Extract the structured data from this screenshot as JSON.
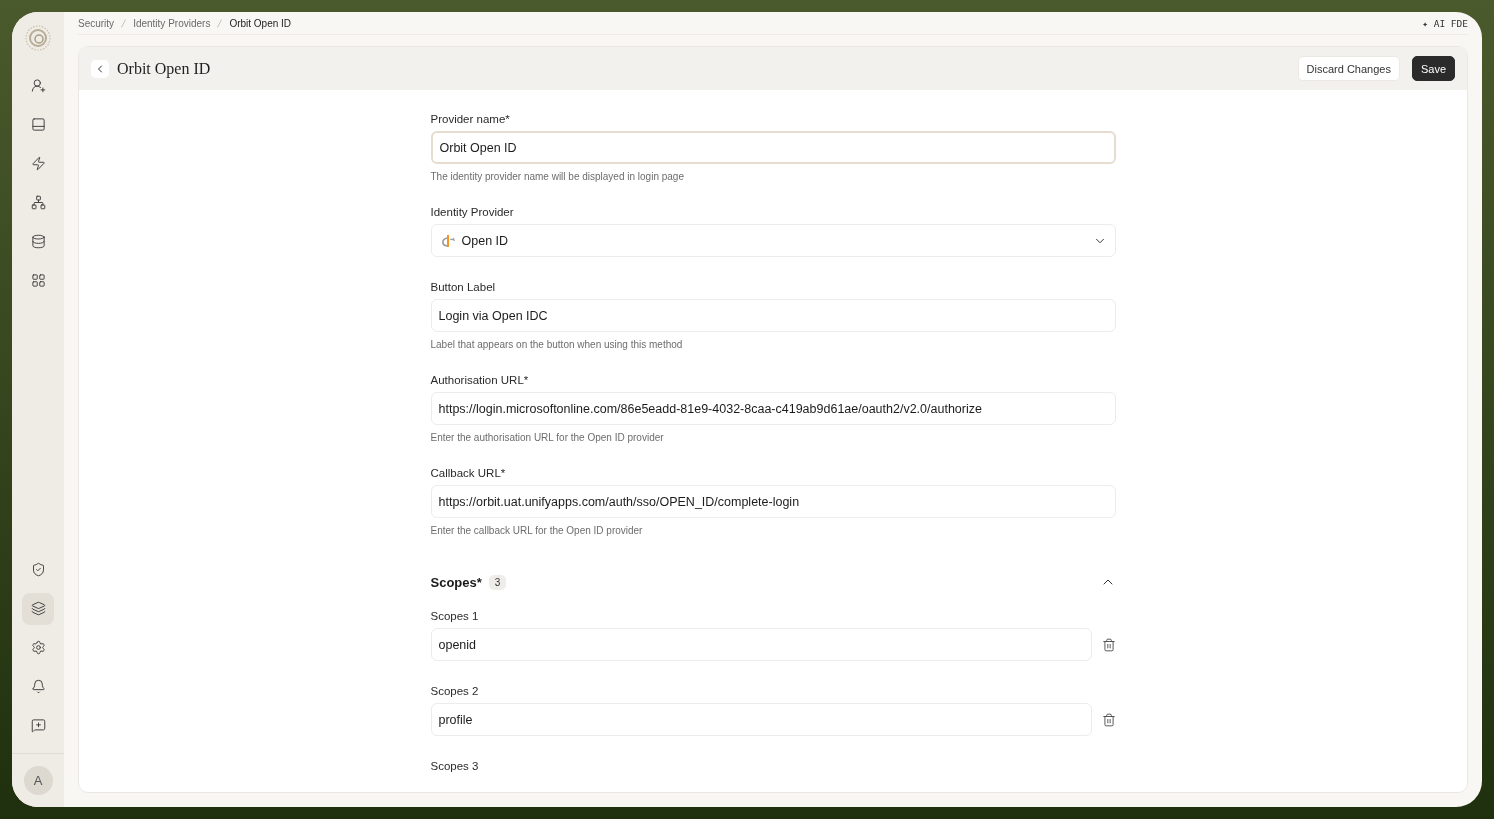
{
  "sidebar": {
    "top_items": [
      {
        "selected": false
      },
      {
        "selected": false
      },
      {
        "selected": false
      },
      {
        "selected": false
      },
      {
        "selected": false
      },
      {
        "selected": false
      }
    ],
    "bottom_items": [
      {
        "selected": false
      },
      {
        "selected": true
      },
      {
        "selected": false
      },
      {
        "selected": false
      },
      {
        "selected": false
      }
    ],
    "avatar": "A"
  },
  "breadcrumbs": [
    "Security",
    "Identity Providers",
    "Orbit Open ID"
  ],
  "assistant": {
    "icon": "✦",
    "label": "AI FDE"
  },
  "header": {
    "title": "Orbit Open ID",
    "buttons": [
      {
        "label": "Discard Changes",
        "kind": "secondary"
      },
      {
        "label": "Save",
        "kind": "primary"
      }
    ]
  },
  "fields": [
    {
      "kind": "text",
      "label": "Provider name*",
      "value": "Orbit Open ID",
      "focused": true,
      "hint": "The identity provider name will be displayed in login page"
    },
    {
      "kind": "select",
      "label": "Identity Provider",
      "value": "Open ID",
      "focused": false
    },
    {
      "kind": "text",
      "label": "Button Label",
      "value": "Login via Open IDC",
      "focused": false,
      "hint": "Label that appears on the button when using this method"
    },
    {
      "kind": "text",
      "label": "Authorisation URL*",
      "value": "https://login.microsoftonline.com/86e5eadd-81e9-4032-8caa-c419ab9d61ae/oauth2/v2.0/authorize",
      "focused": false,
      "hint": "Enter the authorisation URL for the Open ID provider"
    },
    {
      "kind": "text",
      "label": "Callback URL*",
      "value": "https://orbit.uat.unifyapps.com/auth/sso/OPEN_ID/complete-login",
      "focused": false,
      "hint": "Enter the callback URL for the Open ID provider"
    }
  ],
  "scopes": {
    "title": "Scopes*",
    "count": "3",
    "expanded": true,
    "items": [
      {
        "label": "Scopes 1",
        "value": "openid"
      },
      {
        "label": "Scopes 2",
        "value": "profile"
      },
      {
        "label": "Scopes 3"
      }
    ]
  }
}
